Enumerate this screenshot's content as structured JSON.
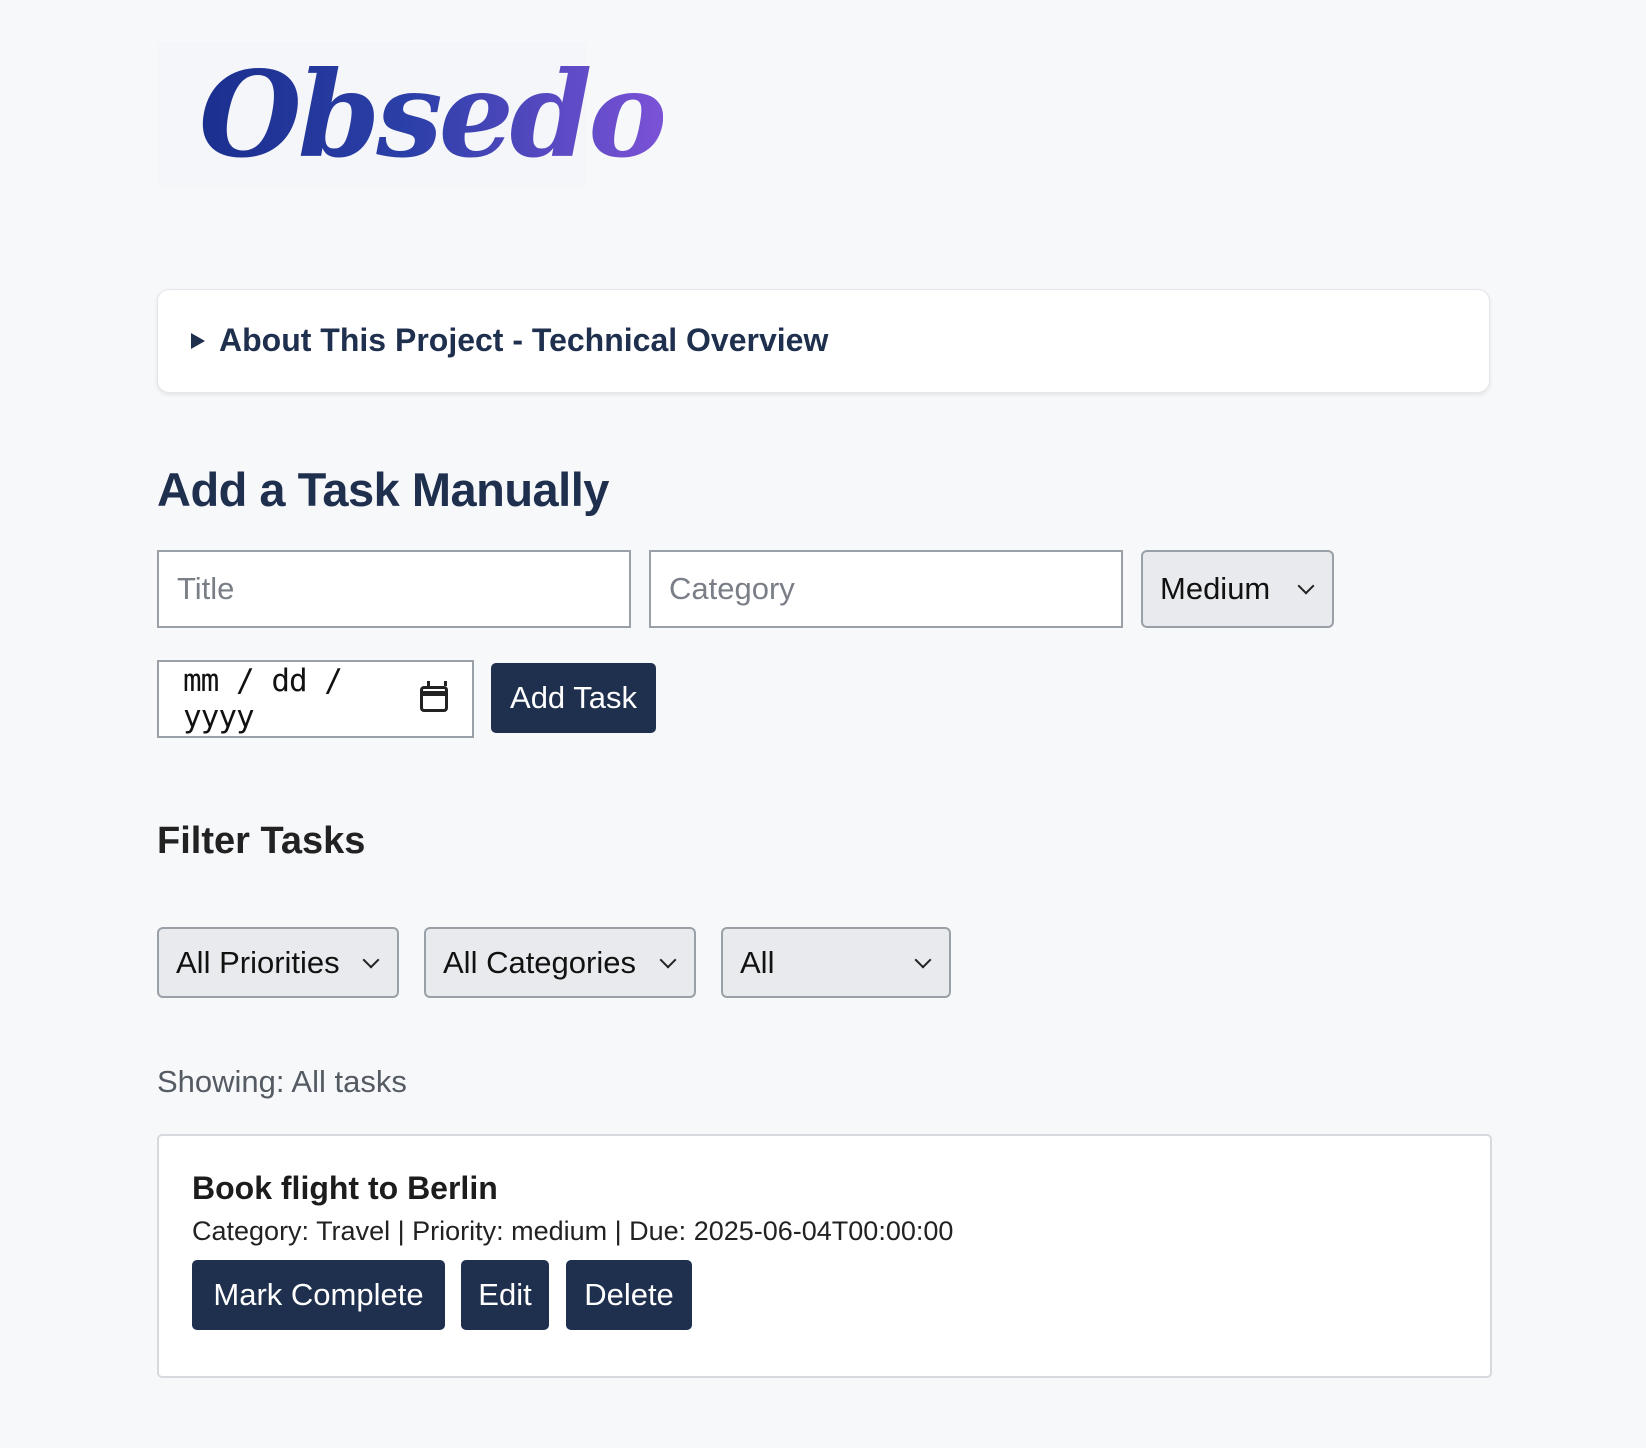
{
  "brand": {
    "logo_text": "Obsedo",
    "gradient": [
      "#1b2f8f",
      "#7b52d6"
    ]
  },
  "about": {
    "summary": "About This Project - Technical Overview"
  },
  "add_task": {
    "heading": "Add a Task Manually",
    "title_placeholder": "Title",
    "category_placeholder": "Category",
    "priority_selected": "Medium",
    "date_placeholder": "mm / dd / yyyy",
    "submit_label": "Add Task"
  },
  "filters": {
    "heading": "Filter Tasks",
    "priority_selected": "All Priorities",
    "category_selected": "All Categories",
    "status_selected": "All",
    "showing_text": "Showing: All tasks"
  },
  "tasks": [
    {
      "title": "Book flight to Berlin",
      "meta": "Category: Travel | Priority: medium | Due: 2025-06-04T00:00:00",
      "actions": {
        "complete": "Mark Complete",
        "edit": "Edit",
        "delete": "Delete"
      }
    }
  ],
  "colors": {
    "accent": "#1f2f4e",
    "background": "#f7f8fa",
    "card": "#ffffff",
    "select_bg": "#e9eaee"
  }
}
